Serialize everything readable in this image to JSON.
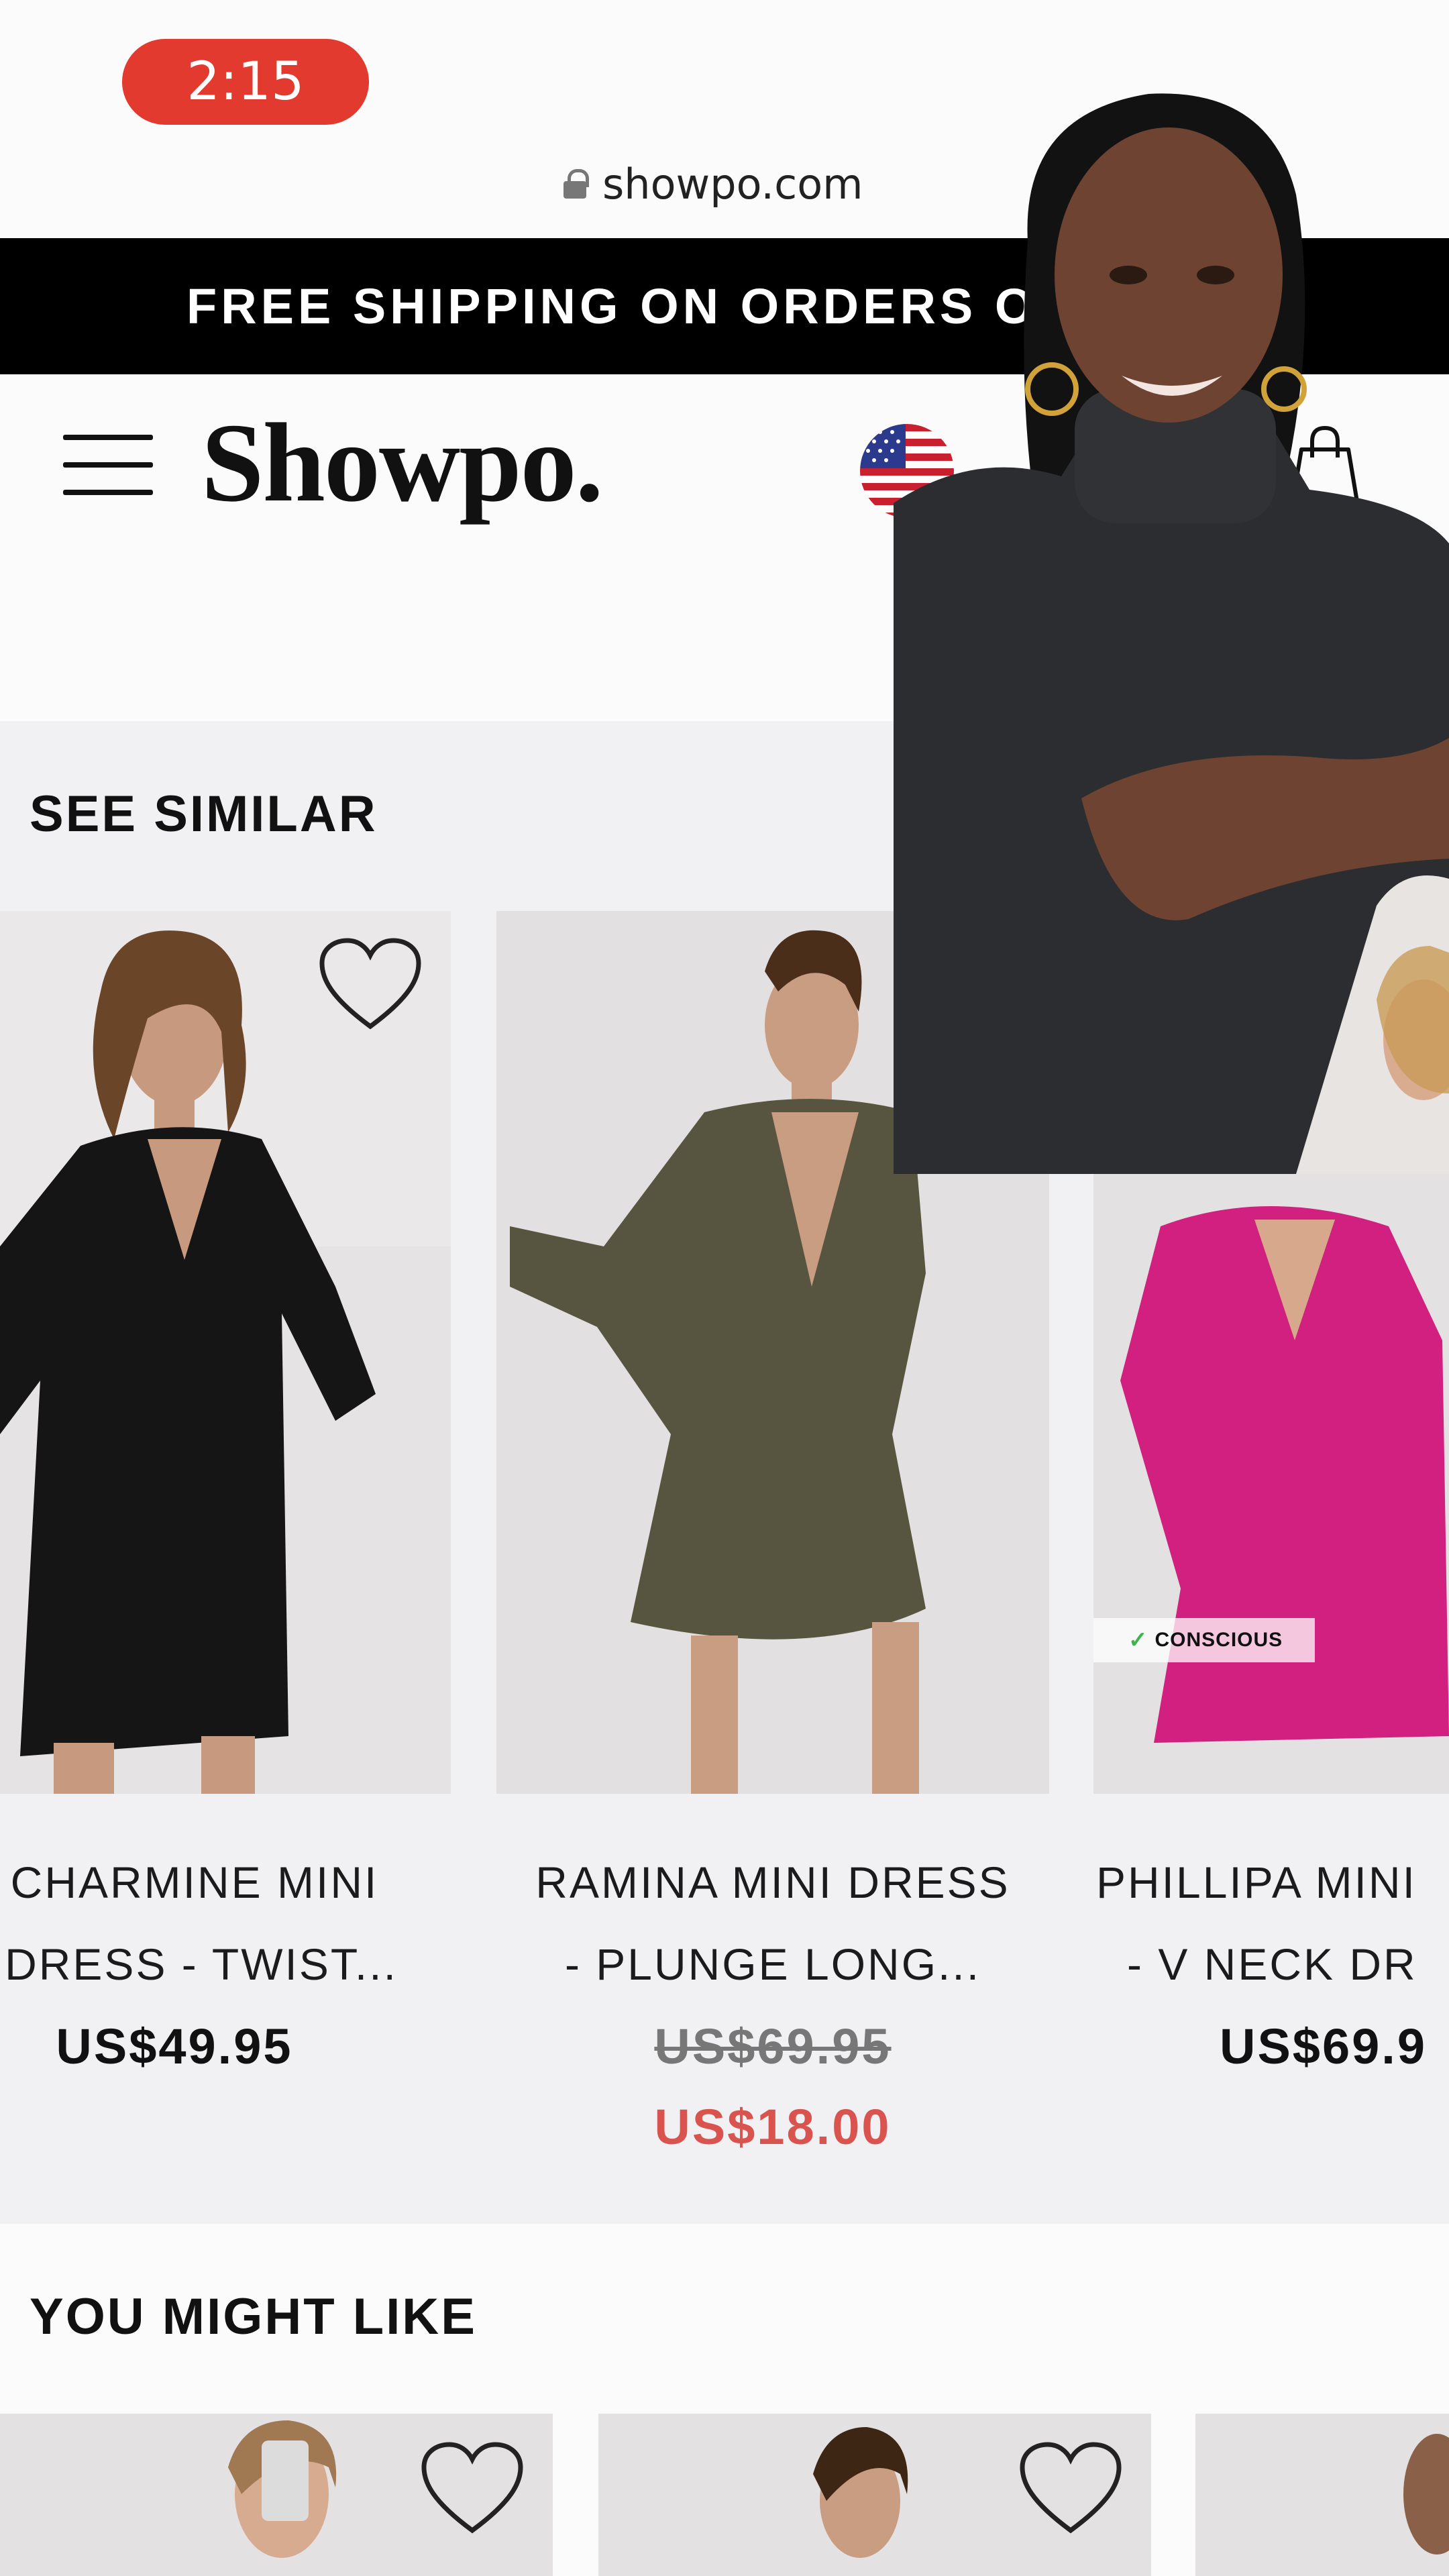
{
  "status_bar": {
    "time": "2:15"
  },
  "browser": {
    "url": "showpo.com"
  },
  "promo_banner": {
    "text": "FREE SHIPPING ON ORDERS O"
  },
  "header": {
    "logo": "Showpo."
  },
  "see_similar": {
    "title": "SEE SIMILAR",
    "products": [
      {
        "title_line1": "CHARMINE MINI",
        "title_line2": "DRESS - TWIST...",
        "price": "US$49.95"
      },
      {
        "title_line1": "RAMINA MINI DRESS",
        "title_line2": "- PLUNGE LONG...",
        "original_price": "US$69.95",
        "sale_price": "US$18.00"
      },
      {
        "title_line1": "PHILLIPA MINI",
        "title_line2": "- V NECK DR",
        "price": "US$69.9",
        "badge": "CONSCIOUS"
      }
    ]
  },
  "you_might_like": {
    "title": "YOU MIGHT LIKE"
  },
  "colors": {
    "promo_bg": "#000000",
    "sale_red": "#d9534f",
    "time_pill": "#e23a2f",
    "section_bg": "#f1f1f4"
  }
}
